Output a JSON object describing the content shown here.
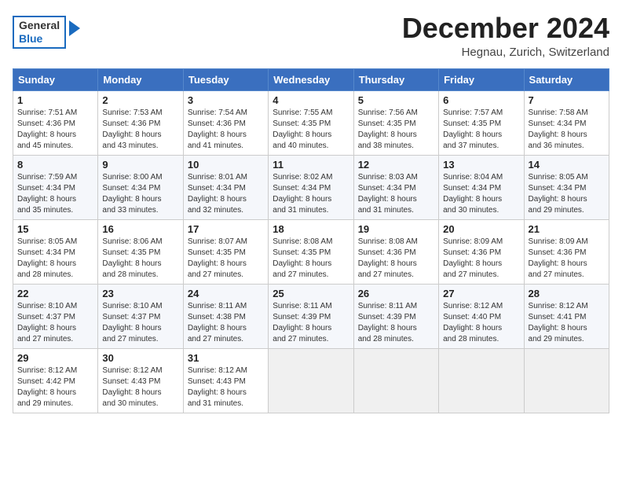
{
  "header": {
    "logo_line1": "General",
    "logo_line2": "Blue",
    "month": "December 2024",
    "location": "Hegnau, Zurich, Switzerland"
  },
  "weekdays": [
    "Sunday",
    "Monday",
    "Tuesday",
    "Wednesday",
    "Thursday",
    "Friday",
    "Saturday"
  ],
  "weeks": [
    [
      {
        "day": "1",
        "info": "Sunrise: 7:51 AM\nSunset: 4:36 PM\nDaylight: 8 hours\nand 45 minutes."
      },
      {
        "day": "2",
        "info": "Sunrise: 7:53 AM\nSunset: 4:36 PM\nDaylight: 8 hours\nand 43 minutes."
      },
      {
        "day": "3",
        "info": "Sunrise: 7:54 AM\nSunset: 4:36 PM\nDaylight: 8 hours\nand 41 minutes."
      },
      {
        "day": "4",
        "info": "Sunrise: 7:55 AM\nSunset: 4:35 PM\nDaylight: 8 hours\nand 40 minutes."
      },
      {
        "day": "5",
        "info": "Sunrise: 7:56 AM\nSunset: 4:35 PM\nDaylight: 8 hours\nand 38 minutes."
      },
      {
        "day": "6",
        "info": "Sunrise: 7:57 AM\nSunset: 4:35 PM\nDaylight: 8 hours\nand 37 minutes."
      },
      {
        "day": "7",
        "info": "Sunrise: 7:58 AM\nSunset: 4:34 PM\nDaylight: 8 hours\nand 36 minutes."
      }
    ],
    [
      {
        "day": "8",
        "info": "Sunrise: 7:59 AM\nSunset: 4:34 PM\nDaylight: 8 hours\nand 35 minutes."
      },
      {
        "day": "9",
        "info": "Sunrise: 8:00 AM\nSunset: 4:34 PM\nDaylight: 8 hours\nand 33 minutes."
      },
      {
        "day": "10",
        "info": "Sunrise: 8:01 AM\nSunset: 4:34 PM\nDaylight: 8 hours\nand 32 minutes."
      },
      {
        "day": "11",
        "info": "Sunrise: 8:02 AM\nSunset: 4:34 PM\nDaylight: 8 hours\nand 31 minutes."
      },
      {
        "day": "12",
        "info": "Sunrise: 8:03 AM\nSunset: 4:34 PM\nDaylight: 8 hours\nand 31 minutes."
      },
      {
        "day": "13",
        "info": "Sunrise: 8:04 AM\nSunset: 4:34 PM\nDaylight: 8 hours\nand 30 minutes."
      },
      {
        "day": "14",
        "info": "Sunrise: 8:05 AM\nSunset: 4:34 PM\nDaylight: 8 hours\nand 29 minutes."
      }
    ],
    [
      {
        "day": "15",
        "info": "Sunrise: 8:05 AM\nSunset: 4:34 PM\nDaylight: 8 hours\nand 28 minutes."
      },
      {
        "day": "16",
        "info": "Sunrise: 8:06 AM\nSunset: 4:35 PM\nDaylight: 8 hours\nand 28 minutes."
      },
      {
        "day": "17",
        "info": "Sunrise: 8:07 AM\nSunset: 4:35 PM\nDaylight: 8 hours\nand 27 minutes."
      },
      {
        "day": "18",
        "info": "Sunrise: 8:08 AM\nSunset: 4:35 PM\nDaylight: 8 hours\nand 27 minutes."
      },
      {
        "day": "19",
        "info": "Sunrise: 8:08 AM\nSunset: 4:36 PM\nDaylight: 8 hours\nand 27 minutes."
      },
      {
        "day": "20",
        "info": "Sunrise: 8:09 AM\nSunset: 4:36 PM\nDaylight: 8 hours\nand 27 minutes."
      },
      {
        "day": "21",
        "info": "Sunrise: 8:09 AM\nSunset: 4:36 PM\nDaylight: 8 hours\nand 27 minutes."
      }
    ],
    [
      {
        "day": "22",
        "info": "Sunrise: 8:10 AM\nSunset: 4:37 PM\nDaylight: 8 hours\nand 27 minutes."
      },
      {
        "day": "23",
        "info": "Sunrise: 8:10 AM\nSunset: 4:37 PM\nDaylight: 8 hours\nand 27 minutes."
      },
      {
        "day": "24",
        "info": "Sunrise: 8:11 AM\nSunset: 4:38 PM\nDaylight: 8 hours\nand 27 minutes."
      },
      {
        "day": "25",
        "info": "Sunrise: 8:11 AM\nSunset: 4:39 PM\nDaylight: 8 hours\nand 27 minutes."
      },
      {
        "day": "26",
        "info": "Sunrise: 8:11 AM\nSunset: 4:39 PM\nDaylight: 8 hours\nand 28 minutes."
      },
      {
        "day": "27",
        "info": "Sunrise: 8:12 AM\nSunset: 4:40 PM\nDaylight: 8 hours\nand 28 minutes."
      },
      {
        "day": "28",
        "info": "Sunrise: 8:12 AM\nSunset: 4:41 PM\nDaylight: 8 hours\nand 29 minutes."
      }
    ],
    [
      {
        "day": "29",
        "info": "Sunrise: 8:12 AM\nSunset: 4:42 PM\nDaylight: 8 hours\nand 29 minutes."
      },
      {
        "day": "30",
        "info": "Sunrise: 8:12 AM\nSunset: 4:43 PM\nDaylight: 8 hours\nand 30 minutes."
      },
      {
        "day": "31",
        "info": "Sunrise: 8:12 AM\nSunset: 4:43 PM\nDaylight: 8 hours\nand 31 minutes."
      },
      null,
      null,
      null,
      null
    ]
  ]
}
